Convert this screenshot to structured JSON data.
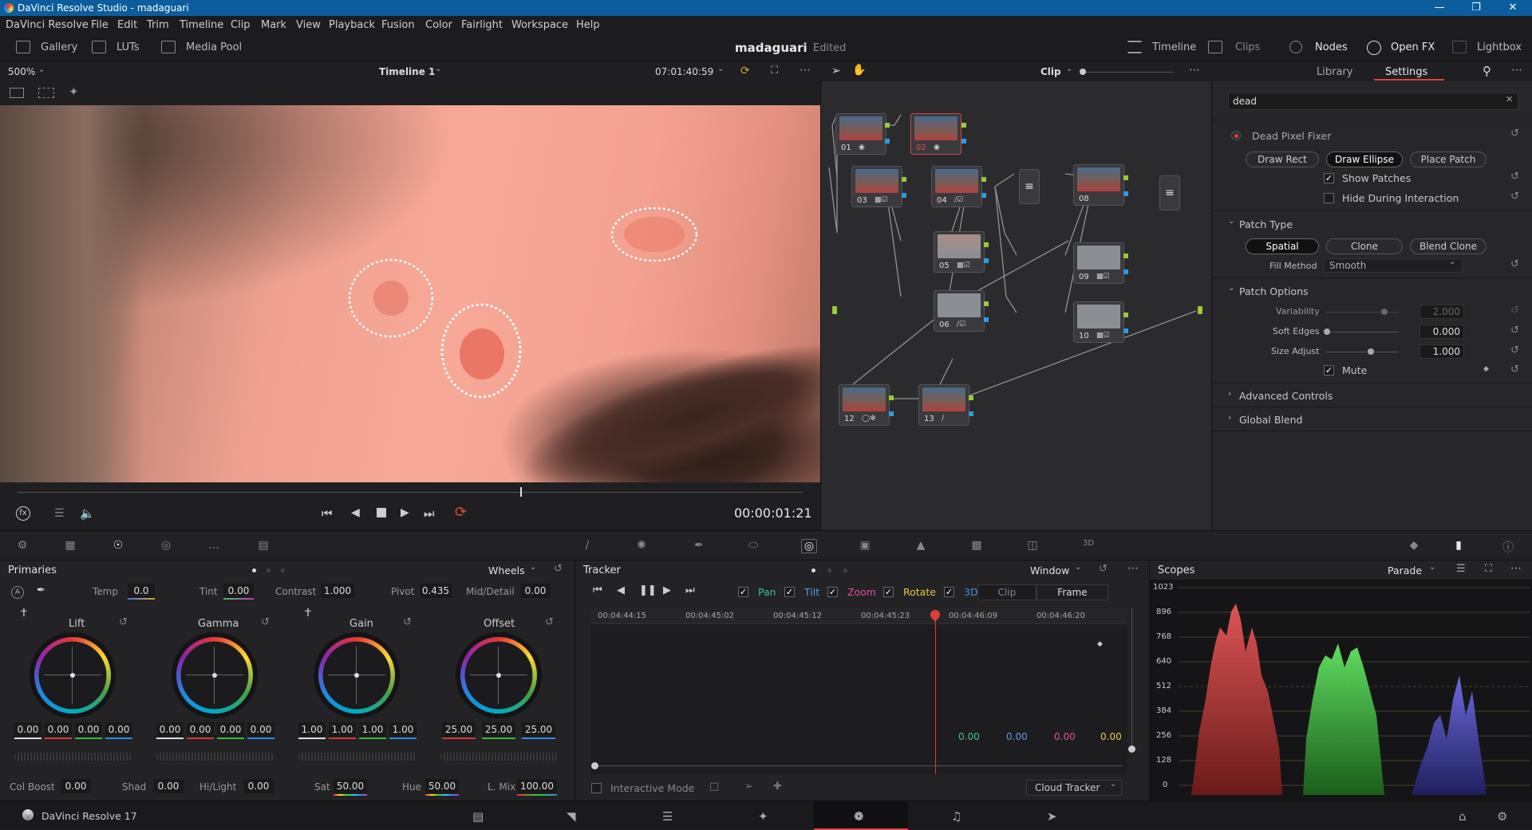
{
  "window": {
    "title": "DaVinci Resolve Studio - madaguari"
  },
  "menu": [
    "DaVinci Resolve",
    "File",
    "Edit",
    "Trim",
    "Timeline",
    "Clip",
    "Mark",
    "View",
    "Playback",
    "Fusion",
    "Color",
    "Fairlight",
    "Workspace",
    "Help"
  ],
  "pagebar": {
    "left": [
      "Gallery",
      "LUTs",
      "Media Pool"
    ],
    "project": "madaguari",
    "status": "Edited",
    "right": [
      "Timeline",
      "Clips",
      "Nodes",
      "Open FX",
      "Lightbox"
    ]
  },
  "viewer": {
    "zoom": "500%",
    "timeline": "Timeline 1",
    "timecode": "07:01:40:59",
    "playhead_fraction": 0.64,
    "current_time": "00:00:01:21"
  },
  "nodes": {
    "mode": "Clip",
    "items": [
      {
        "num": "01"
      },
      {
        "num": "02"
      },
      {
        "num": "03"
      },
      {
        "num": "04"
      },
      {
        "num": "05"
      },
      {
        "num": "06"
      },
      {
        "num": "08"
      },
      {
        "num": "09"
      },
      {
        "num": "10"
      },
      {
        "num": "12"
      },
      {
        "num": "13"
      }
    ]
  },
  "openfx": {
    "tabs": [
      "Library",
      "Settings"
    ],
    "search": "dead",
    "plugin": "Dead Pixel Fixer",
    "draw_buttons": [
      "Draw Rect",
      "Draw Ellipse",
      "Place Patch"
    ],
    "show_patches": "Show Patches",
    "hide_during": "Hide During Interaction",
    "patch_type_title": "Patch Type",
    "patch_types": [
      "Spatial",
      "Clone",
      "Blend Clone"
    ],
    "fill_method_label": "Fill Method",
    "fill_method_value": "Smooth",
    "patch_options_title": "Patch Options",
    "variability_label": "Variability",
    "variability_value": "2.000",
    "soft_edges_label": "Soft Edges",
    "soft_edges_value": "0.000",
    "size_adjust_label": "Size Adjust",
    "size_adjust_value": "1.000",
    "mute_label": "Mute",
    "advanced": "Advanced Controls",
    "global_blend": "Global Blend"
  },
  "primaries": {
    "title": "Primaries",
    "mode": "Wheels",
    "temp_label": "Temp",
    "temp": "0.0",
    "tint_label": "Tint",
    "tint": "0.00",
    "contrast_label": "Contrast",
    "contrast": "1.000",
    "pivot_label": "Pivot",
    "pivot": "0.435",
    "middetail_label": "Mid/Detail",
    "middetail": "0.00",
    "wheels": [
      {
        "name": "Lift",
        "values": [
          "0.00",
          "0.00",
          "0.00",
          "0.00"
        ]
      },
      {
        "name": "Gamma",
        "values": [
          "0.00",
          "0.00",
          "0.00",
          "0.00"
        ]
      },
      {
        "name": "Gain",
        "values": [
          "1.00",
          "1.00",
          "1.00",
          "1.00"
        ]
      },
      {
        "name": "Offset",
        "values": [
          "25.00",
          "25.00",
          "25.00"
        ]
      }
    ],
    "colboost_label": "Col Boost",
    "colboost": "0.00",
    "shad_label": "Shad",
    "shad": "0.00",
    "hilight_label": "Hi/Light",
    "hilight": "0.00",
    "sat_label": "Sat",
    "sat": "50.00",
    "hue_label": "Hue",
    "hue": "50.00",
    "lmix_label": "L. Mix",
    "lmix": "100.00"
  },
  "tracker": {
    "title": "Tracker",
    "mode": "Window",
    "checks": [
      "Pan",
      "Tilt",
      "Zoom",
      "Rotate",
      "3D"
    ],
    "check_colors": [
      "#3cc3a3",
      "#5b9be8",
      "#e04f9c",
      "#e8c84b",
      "#3f8fe0"
    ],
    "segments": [
      "Clip",
      "Frame"
    ],
    "times": [
      "00:04:44:15",
      "00:04:45:02",
      "00:04:45:12",
      "00:04:45:23",
      "00:04:46:09",
      "00:04:46:20"
    ],
    "values": [
      "0.00",
      "0.00",
      "0.00",
      "0.00"
    ],
    "interactive": "Interactive Mode",
    "cloud": "Cloud Tracker"
  },
  "scopes": {
    "title": "Scopes",
    "mode": "Parade",
    "ticks": [
      "1023",
      "896",
      "768",
      "640",
      "512",
      "384",
      "256",
      "128",
      "0"
    ]
  },
  "status": {
    "app": "DaVinci Resolve 17"
  }
}
